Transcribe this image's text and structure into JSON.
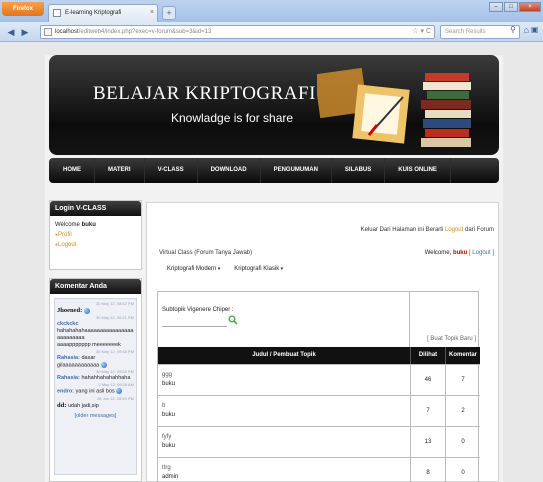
{
  "browser": {
    "app_button": "Firefox",
    "tab_title": "E-learning Kriptografi",
    "url_host": "localhost",
    "url_path": "/editweb4/index.php?exec=v-forum&sub=3&id=13",
    "search_placeholder": "Search Results"
  },
  "header": {
    "logo_title": "BELAJAR KRIPTOGRAFI",
    "tagline": "Knowladge is for share"
  },
  "menu": {
    "items": [
      "HOME",
      "MATERI",
      "V-CLASS",
      "DOWNLOAD",
      "PENGUMUMAN",
      "SILABUS",
      "KUIS ONLINE"
    ]
  },
  "sidebar": {
    "login_title": "Login V-CLASS",
    "welcome_label": "Welcome",
    "welcome_user": "buku",
    "links": [
      "Profil",
      "Logout"
    ],
    "komentar_title": "Komentar Anda",
    "shouts": [
      {
        "date": "30 May 12, 08:42 PM",
        "name": "Jhoened",
        "message": ""
      },
      {
        "date": "30 May 12, 09:21 PM",
        "name": "",
        "message": "ckckckc"
      },
      {
        "date": "",
        "name": "",
        "message": "hahahahahaaaaaaaaaaaaaaaaaaaaaaaaa"
      },
      {
        "date": "",
        "name": "",
        "message": "aaaappppppp meeeeeeek"
      },
      {
        "date": "30 May 12, 09:48 PM",
        "name": "Rahasia",
        "message": "dasar"
      },
      {
        "date": "",
        "name": "",
        "message": "gilaaaaaaaaaaaa"
      },
      {
        "date": "30 May 12, 09:53 PM",
        "name": "Rahasia",
        "message": "hahahhahahahhaha"
      },
      {
        "date": "2 May 12, 08:28 AM",
        "name": "endro",
        "message": "yang ini asli bos"
      },
      {
        "date": "28 Jun 12, 08:54 PM",
        "name": "dd",
        "message": "udah jadi,sip"
      }
    ],
    "older_link": "[older messages]"
  },
  "content": {
    "logout_prefix": "Keluar Dari Halaman ini Berarti",
    "logout_link": "Logout",
    "logout_suffix": "dari Forum",
    "vclass_title": "Virtual Class (Forum Tanya Jawab)",
    "welcome_label": "Welcome,",
    "welcome_user": "buku",
    "welcome_logout": "[ Logout ]",
    "dropdowns": [
      "Kriptografi Modern",
      "Kriptografi Klasik"
    ],
    "subtopic_label": "Subtopik Vigenere Chiper :",
    "subtopic_value": "",
    "buat_topik": "[ Buat Topik Baru ]",
    "columns": [
      "Judul / Pembuat Topik",
      "Dilihat",
      "Komentar"
    ],
    "rows": [
      {
        "title": "ggg",
        "author": "buku",
        "views": "46",
        "comments": "7"
      },
      {
        "title": "b",
        "author": "buku",
        "views": "7",
        "comments": "2"
      },
      {
        "title": "fyfy",
        "author": "buku",
        "views": "13",
        "comments": "0"
      },
      {
        "title": "ttrg",
        "author": "admin",
        "views": "8",
        "comments": "0"
      }
    ]
  },
  "colors": {
    "accent_orange": "#d28a1e",
    "header_black": "#111111",
    "link_blue": "#3e6ea7",
    "user_red": "#cc0000"
  }
}
